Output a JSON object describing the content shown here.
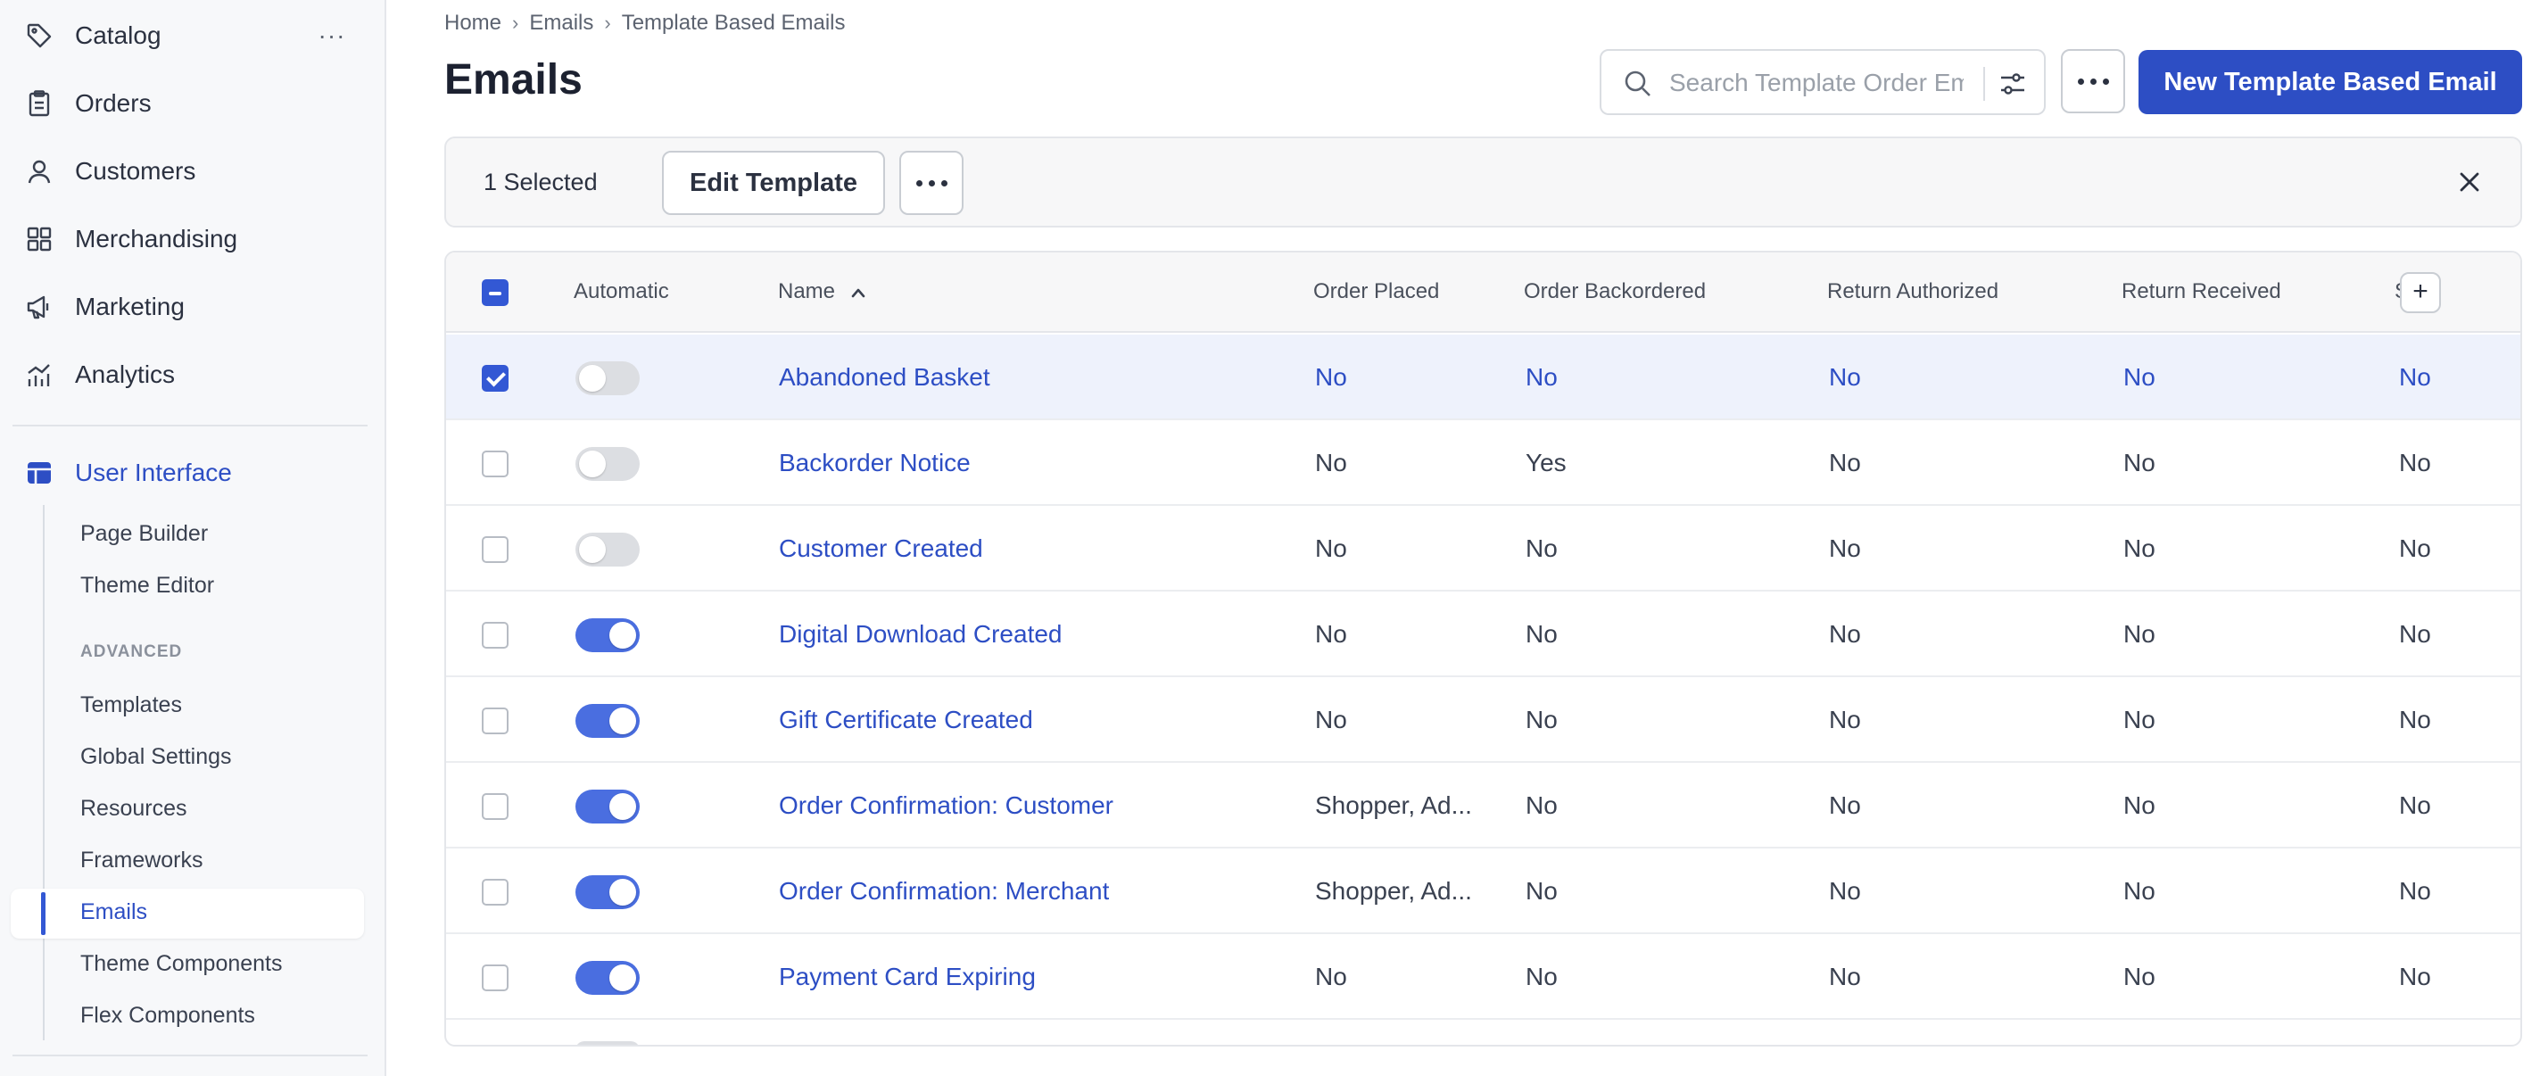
{
  "sidebar": {
    "items": [
      {
        "label": "Catalog",
        "icon": "tag-icon"
      },
      {
        "label": "Orders",
        "icon": "clipboard-icon"
      },
      {
        "label": "Customers",
        "icon": "user-icon"
      },
      {
        "label": "Merchandising",
        "icon": "grid-icon"
      },
      {
        "label": "Marketing",
        "icon": "megaphone-icon"
      },
      {
        "label": "Analytics",
        "icon": "bar-chart-icon"
      }
    ],
    "active_section": {
      "label": "User Interface",
      "icon": "layout-icon"
    },
    "sub_items": [
      "Page Builder",
      "Theme Editor"
    ],
    "advanced_label": "ADVANCED",
    "advanced_items": [
      "Templates",
      "Global Settings",
      "Resources",
      "Frameworks",
      "Emails",
      "Theme Components",
      "Flex Components"
    ],
    "active_item": "Emails",
    "accent_color": "#2d4ec4"
  },
  "breadcrumb": [
    "Home",
    "Emails",
    "Template Based Emails"
  ],
  "page_title": "Emails",
  "search": {
    "placeholder": "Search Template Order Emails",
    "value": ""
  },
  "new_button_label": "New Template Based Email",
  "selection": {
    "count_label": "1 Selected",
    "edit_label": "Edit Template"
  },
  "table": {
    "columns": [
      "Automatic",
      "Name",
      "Order Placed",
      "Order Backordered",
      "Return Authorized",
      "Return Received",
      "S"
    ],
    "sort": {
      "column": "Name",
      "direction": "ascending"
    },
    "rows": [
      {
        "selected": true,
        "automatic": false,
        "name": "Abandoned Basket",
        "order_placed": "No",
        "order_backordered": "No",
        "return_authorized": "No",
        "return_received": "No",
        "s": "No"
      },
      {
        "selected": false,
        "automatic": false,
        "name": "Backorder Notice",
        "order_placed": "No",
        "order_backordered": "Yes",
        "return_authorized": "No",
        "return_received": "No",
        "s": "No"
      },
      {
        "selected": false,
        "automatic": false,
        "name": "Customer Created",
        "order_placed": "No",
        "order_backordered": "No",
        "return_authorized": "No",
        "return_received": "No",
        "s": "No"
      },
      {
        "selected": false,
        "automatic": true,
        "name": "Digital Download Created",
        "order_placed": "No",
        "order_backordered": "No",
        "return_authorized": "No",
        "return_received": "No",
        "s": "No"
      },
      {
        "selected": false,
        "automatic": true,
        "name": "Gift Certificate Created",
        "order_placed": "No",
        "order_backordered": "No",
        "return_authorized": "No",
        "return_received": "No",
        "s": "No"
      },
      {
        "selected": false,
        "automatic": true,
        "name": "Order Confirmation: Customer",
        "order_placed": "Shopper, Ad...",
        "order_backordered": "No",
        "return_authorized": "No",
        "return_received": "No",
        "s": "No"
      },
      {
        "selected": false,
        "automatic": true,
        "name": "Order Confirmation: Merchant",
        "order_placed": "Shopper, Ad...",
        "order_backordered": "No",
        "return_authorized": "No",
        "return_received": "No",
        "s": "No"
      },
      {
        "selected": false,
        "automatic": true,
        "name": "Payment Card Expiring",
        "order_placed": "No",
        "order_backordered": "No",
        "return_authorized": "No",
        "return_received": "No",
        "s": "No"
      }
    ]
  }
}
